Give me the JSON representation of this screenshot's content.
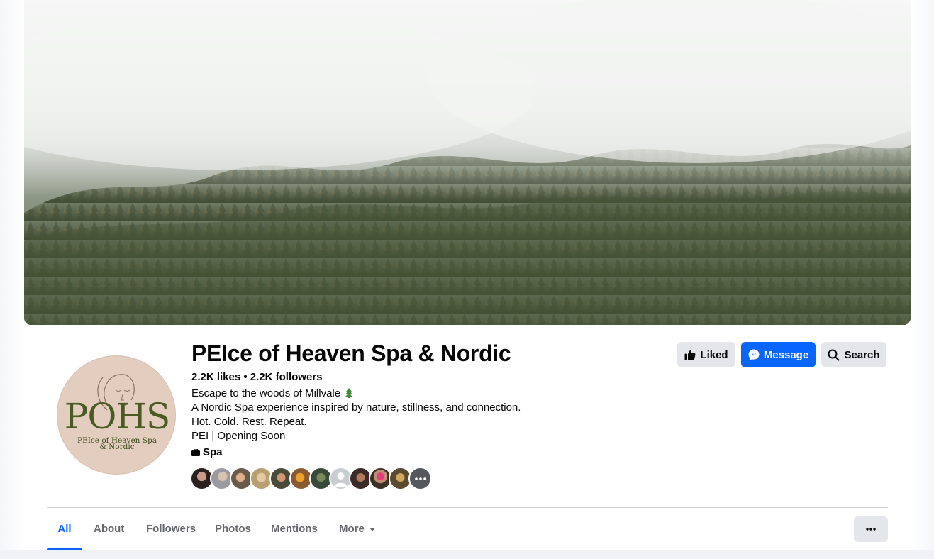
{
  "page": {
    "name": "PEIce of Heaven Spa & Nordic",
    "stats": "2.2K likes • 2.2K followers",
    "bio": [
      "Escape to the woods of Millvale",
      "A Nordic Spa experience inspired by nature, stillness, and connection.",
      "Hot. Cold. Rest. Repeat.",
      "PEI | Opening Soon"
    ],
    "category": "Spa",
    "logo": {
      "letters": "POHS",
      "line1": "PEIce of Heaven Spa",
      "line2": "& Nordic"
    }
  },
  "actions": {
    "liked": "Liked",
    "message": "Message",
    "search": "Search"
  },
  "tabs": {
    "all": "All",
    "about": "About",
    "followers": "Followers",
    "photos": "Photos",
    "mentions": "Mentions",
    "more": "More"
  },
  "icons": {
    "liked": "thumbs-up-icon",
    "message": "messenger-icon",
    "search": "search-icon",
    "category": "category-icon",
    "overflow": "more-options-icon",
    "tree": "evergreen-tree-emoji"
  },
  "colors": {
    "accent": "#0866ff",
    "button_gray": "#e4e6eb",
    "text_secondary": "#65676b",
    "logo_green": "#4a5a22",
    "logo_bg": "#e3cdbf"
  }
}
